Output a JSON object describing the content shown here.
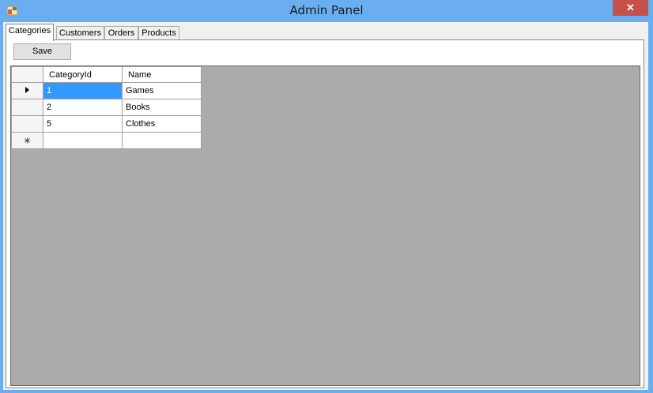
{
  "window": {
    "title": "Admin Panel",
    "close_glyph": "✕"
  },
  "tabs": [
    {
      "label": "Categories",
      "active": true
    },
    {
      "label": "Customers",
      "active": false
    },
    {
      "label": "Orders",
      "active": false
    },
    {
      "label": "Products",
      "active": false
    }
  ],
  "toolbar": {
    "save_label": "Save"
  },
  "grid": {
    "columns": [
      "CategoryId",
      "Name"
    ],
    "rows": [
      {
        "id": "1",
        "name": "Games",
        "current": true
      },
      {
        "id": "2",
        "name": "Books",
        "current": false
      },
      {
        "id": "5",
        "name": "Clothes",
        "current": false
      }
    ],
    "new_row_glyph": "✳",
    "colors": {
      "selection": "#3399ff",
      "background": "#ababab"
    }
  }
}
